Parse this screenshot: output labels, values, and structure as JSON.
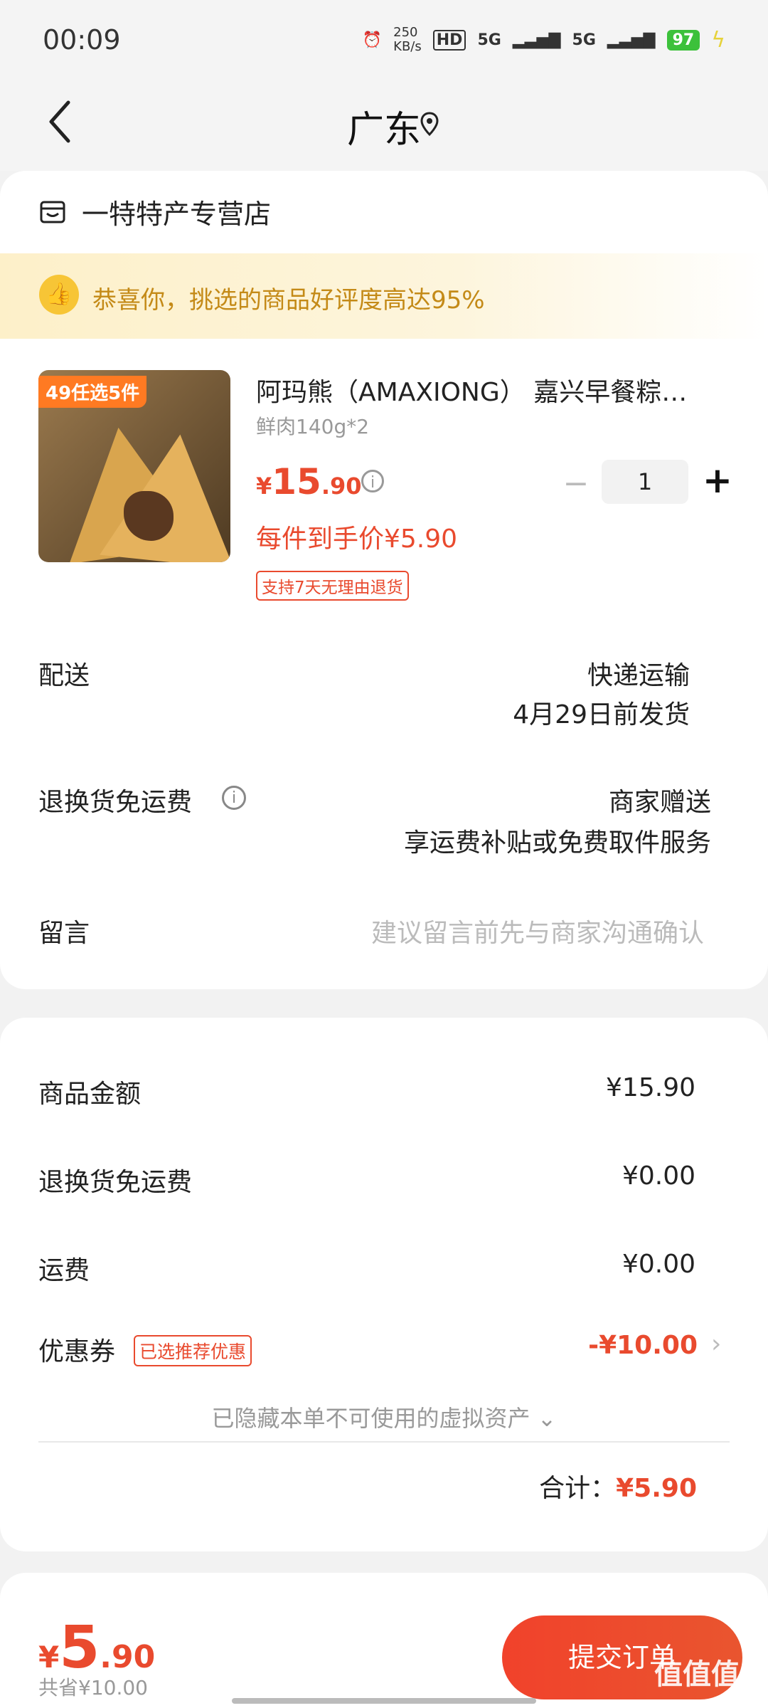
{
  "status_bar": {
    "time": "00:09",
    "speed": "250",
    "speed_unit": "KB/s",
    "hd": "HD",
    "net1": "5G",
    "net2": "5G",
    "battery": "97"
  },
  "header": {
    "region": "广东"
  },
  "store": {
    "name": "一特特产专营店"
  },
  "banner": {
    "text": "恭喜你，挑选的商品好评度高达95%"
  },
  "product": {
    "image_tag": "49任选5件",
    "title": "阿玛熊（AMAXIONG） 嘉兴早餐粽…",
    "spec": "鲜肉140g*2",
    "price_symbol": "¥",
    "price_int": "15",
    "price_dec": ".90",
    "unit_price": "每件到手价¥5.90",
    "return_tag": "支持7天无理由退货",
    "quantity": "1",
    "minus": "−",
    "plus": "+"
  },
  "delivery": {
    "label": "配送",
    "method": "快递运输",
    "ship_date": "4月29日前发货"
  },
  "return_fee": {
    "label": "退换货免运费",
    "value": "商家赠送",
    "note": "享运费补贴或免费取件服务"
  },
  "message": {
    "label": "留言",
    "placeholder": "建议留言前先与商家沟通确认"
  },
  "summary": {
    "goods_label": "商品金额",
    "goods_value": "¥15.90",
    "return_label": "退换货免运费",
    "return_value": "¥0.00",
    "shipping_label": "运费",
    "shipping_value": "¥0.00",
    "coupon_label": "优惠券",
    "coupon_badge": "已选推荐优惠",
    "coupon_value": "-¥10.00",
    "hidden_note": "已隐藏本单不可使用的虚拟资产 ⌄",
    "total_label": "合计：",
    "total_value": "¥5.90"
  },
  "footer": {
    "price_symbol": "¥",
    "price_int": "5",
    "price_dec": ".90",
    "saved": "共省¥10.00",
    "submit": "提交订单",
    "watermark": "值值值"
  },
  "colors": {
    "accent": "#e94a2e",
    "banner_text": "#c48a17"
  }
}
